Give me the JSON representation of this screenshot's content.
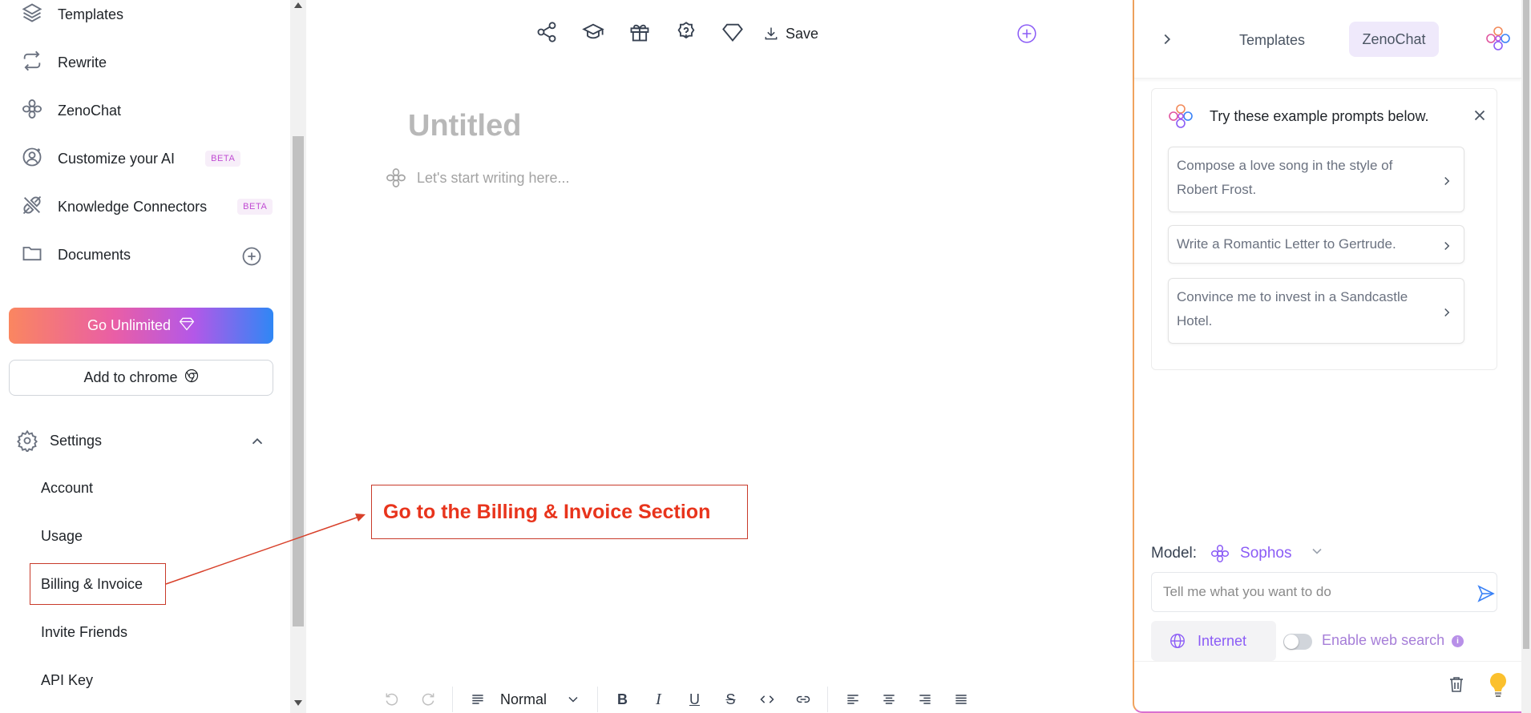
{
  "sidebar": {
    "items": [
      {
        "label": "Templates",
        "icon": "layers-icon"
      },
      {
        "label": "Rewrite",
        "icon": "repeat-icon"
      },
      {
        "label": "ZenoChat",
        "icon": "brain-icon"
      },
      {
        "label": "Customize your AI",
        "icon": "user-settings-icon",
        "badge": "BETA"
      },
      {
        "label": "Knowledge Connectors",
        "icon": "plug-icon",
        "badge": "BETA"
      },
      {
        "label": "Documents",
        "icon": "folder-icon"
      }
    ],
    "go_unlimited": "Go Unlimited",
    "add_to_chrome": "Add to chrome",
    "settings": {
      "label": "Settings",
      "sub_items": [
        "Account",
        "Usage",
        "Billing & Invoice",
        "Invite Friends",
        "API Key"
      ]
    }
  },
  "editor": {
    "toolbar": {
      "icons": [
        "share-icon",
        "graduation-cap-icon",
        "gift-icon",
        "help-icon",
        "diamond-icon"
      ],
      "save_label": "Save"
    },
    "title_placeholder": "Untitled",
    "body_placeholder": "Let's start writing here...",
    "format": {
      "style_label": "Normal"
    }
  },
  "annotation": {
    "text": "Go to the Billing & Invoice Section",
    "color": "#e8341c"
  },
  "chat": {
    "tabs": {
      "templates": "Templates",
      "zenochat": "ZenoChat"
    },
    "prompts_title": "Try these example prompts below.",
    "prompts": [
      "Compose a love song in the style of Robert Frost.",
      "Write a Romantic Letter to Gertrude.",
      "Convince me to invest in a Sandcastle Hotel."
    ],
    "model_label": "Model:",
    "model_name": "Sophos",
    "input_placeholder": "Tell me what you want to do",
    "internet_label": "Internet",
    "web_search_label": "Enable web search",
    "web_search_enabled": false
  },
  "colors": {
    "accent": "#8b5cf6",
    "annotation": "#c83a2a"
  }
}
